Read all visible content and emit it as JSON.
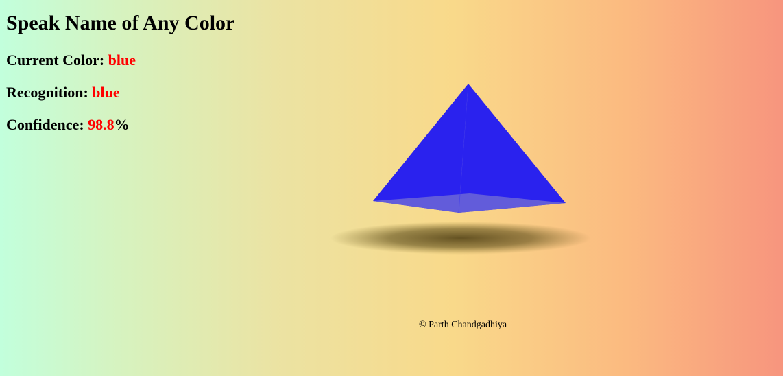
{
  "page": {
    "title": "Speak Name of Any Color"
  },
  "stats": {
    "current_label": "Current Color: ",
    "current_value": "blue",
    "recognition_label": "Recognition: ",
    "recognition_value": "blue",
    "confidence_label": "Confidence: ",
    "confidence_value": "98.8",
    "confidence_unit": "%"
  },
  "shape": {
    "name": "pyramid",
    "color": "#2a22ee"
  },
  "colors": {
    "value_text": "#ff0000",
    "gradient_left": "#c2ffdc",
    "gradient_mid": "#f9d98a",
    "gradient_right": "#f7957e"
  },
  "footer": {
    "copyright": "© Parth Chandgadhiya"
  }
}
